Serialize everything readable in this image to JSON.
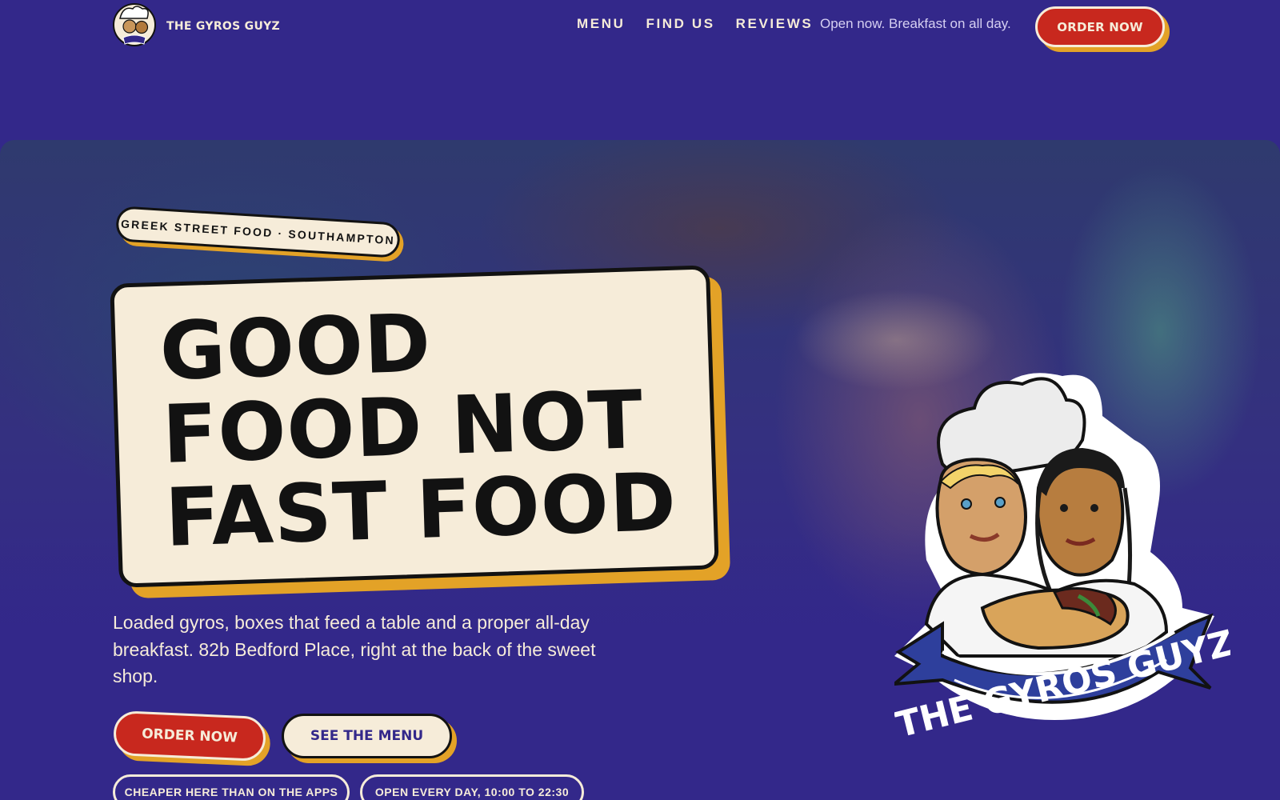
{
  "header": {
    "brand_name": "THE GYROS GUYZ",
    "nav": [
      "MENU",
      "FIND US",
      "REVIEWS"
    ],
    "status": "Open now. Breakfast on all day.",
    "order_label": "ORDER NOW"
  },
  "hero": {
    "eyebrow": "GREEK STREET FOOD · SOUTHAMPTON",
    "headline": [
      "GOOD",
      "FOOD NOT",
      "FAST FOOD"
    ],
    "lede": "Loaded gyros, boxes that feed a table and a proper all-day breakfast. 82b Bedford Place, right at the back of the sweet shop.",
    "order_label": "ORDER NOW",
    "menu_label": "SEE THE MENU",
    "pills": [
      "CHEAPER HERE THAN ON THE APPS",
      "OPEN EVERY DAY, 10:00 TO 22:30"
    ],
    "logo_text": "THE GYROS GUYZ"
  },
  "colors": {
    "background": "#33288a",
    "cream": "#f6ecd9",
    "red": "#c8281e",
    "mustard": "#e3a227",
    "ink": "#121212"
  },
  "icons": {
    "brand_logo": "gyros-guyz-logo-icon",
    "mascot": "gyros-guyz-mascot-icon"
  }
}
